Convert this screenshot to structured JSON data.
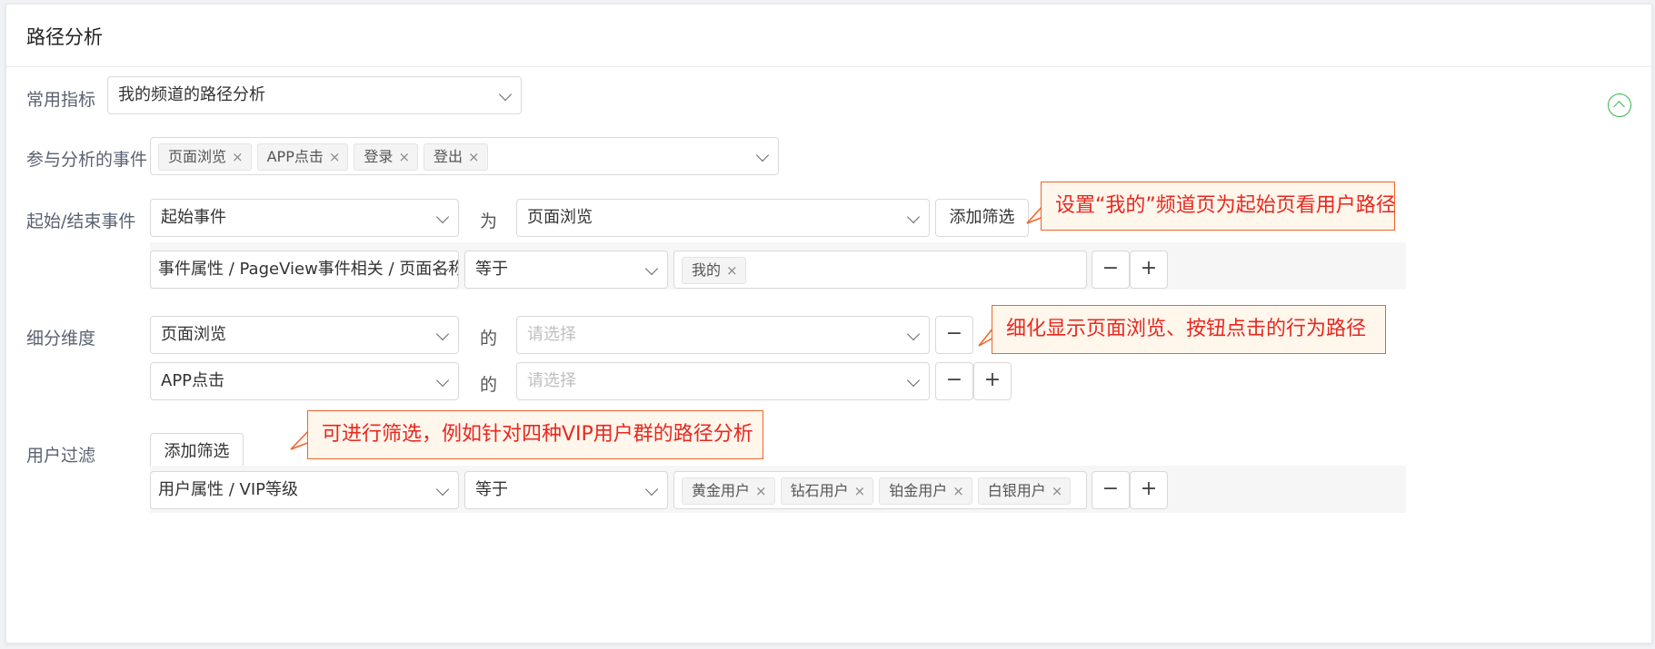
{
  "title": "路径分析",
  "common_metric": {
    "label": "常用指标",
    "value": "我的频道的路径分析"
  },
  "events": {
    "label": "参与分析的事件",
    "tags": [
      "页面浏览",
      "APP点击",
      "登录",
      "登出"
    ]
  },
  "start_end": {
    "label": "起始/结束事件",
    "type_value": "起始事件",
    "connector": "为",
    "event_value": "页面浏览",
    "add_filter": "添加筛选",
    "filter": {
      "property": "事件属性 / PageView事件相关 / 页面名称",
      "operator": "等于",
      "tags": [
        "我的"
      ]
    },
    "callout": "设置“我的”频道页为起始页看用户路径"
  },
  "dimension": {
    "label": "细分维度",
    "rows": [
      {
        "event": "页面浏览",
        "connector": "的",
        "placeholder": "请选择"
      },
      {
        "event": "APP点击",
        "connector": "的",
        "placeholder": "请选择"
      }
    ],
    "callout": "细化显示页面浏览、按钮点击的行为路径"
  },
  "user_filter": {
    "label": "用户过滤",
    "add_filter": "添加筛选",
    "filter": {
      "property": "用户属性 / VIP等级",
      "operator": "等于",
      "tags": [
        "黄金用户",
        "钻石用户",
        "铂金用户",
        "白银用户"
      ]
    },
    "callout": "可进行筛选，例如针对四种VIP用户群的路径分析"
  },
  "symbols": {
    "remove": "×",
    "minus": "−",
    "plus": "+"
  },
  "colors": {
    "accent_green": "#3bb34a",
    "callout_border": "#f0642a",
    "callout_text": "#e8281e",
    "callout_bg": "#fff6ec"
  }
}
